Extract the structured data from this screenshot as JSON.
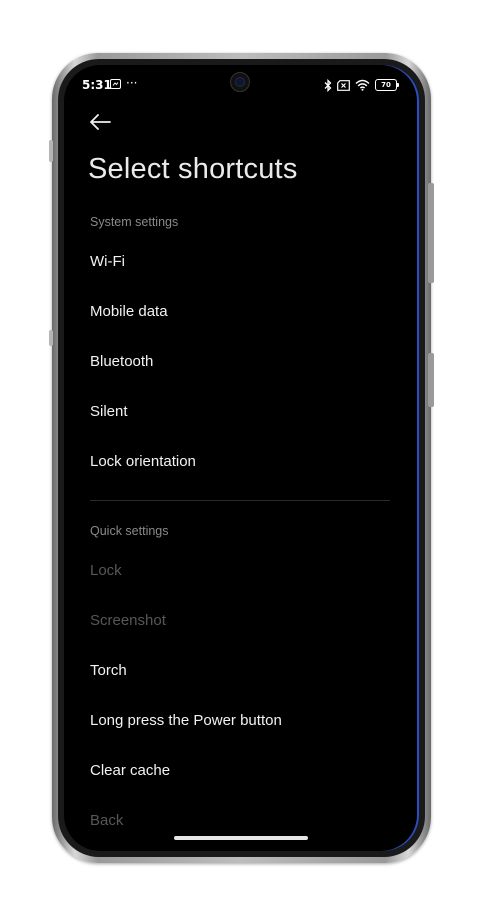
{
  "status_bar": {
    "time": "5:31",
    "dots": "···",
    "battery": "70",
    "icons": [
      "notification-icon",
      "bluetooth-icon",
      "sim-off-icon",
      "wifi-icon",
      "battery-icon"
    ]
  },
  "page": {
    "title": "Select shortcuts"
  },
  "sections": [
    {
      "header": "System settings",
      "items": [
        {
          "label": "Wi-Fi",
          "enabled": true
        },
        {
          "label": "Mobile data",
          "enabled": true
        },
        {
          "label": "Bluetooth",
          "enabled": true
        },
        {
          "label": "Silent",
          "enabled": true
        },
        {
          "label": "Lock orientation",
          "enabled": true
        }
      ]
    },
    {
      "header": "Quick settings",
      "items": [
        {
          "label": "Lock",
          "enabled": false
        },
        {
          "label": "Screenshot",
          "enabled": false
        },
        {
          "label": "Torch",
          "enabled": true
        },
        {
          "label": "Long press the Power button",
          "enabled": true
        },
        {
          "label": "Clear cache",
          "enabled": true
        },
        {
          "label": "Back",
          "enabled": false
        }
      ]
    }
  ],
  "colors": {
    "background": "#000000",
    "text": "#f2f2f2",
    "disabled_text": "#575757",
    "section_header": "#8a8a8a"
  }
}
